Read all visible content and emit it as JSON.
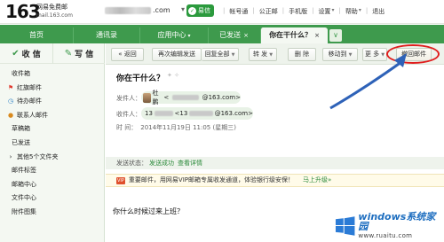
{
  "header": {
    "logo_number": "163",
    "logo_title": "网易免费邮",
    "logo_domain": "mail.163.com",
    "account_suffix": ".com",
    "account_caret": "▾",
    "letter_badge": "易信",
    "links": [
      "帐号通",
      "公正邮",
      "手机版",
      "设置",
      "帮助",
      "退出"
    ]
  },
  "tabs": {
    "home": "首页",
    "contacts": "通讯录",
    "app_center": "应用中心",
    "sent": "已发送",
    "current": "你在干什么？",
    "close": "×",
    "more": "∨"
  },
  "sidebar": {
    "receive": "收 信",
    "compose": "写 信",
    "folders": [
      {
        "label": "收件箱",
        "icon": ""
      },
      {
        "label": "红旗邮件",
        "icon": "flag-icon"
      },
      {
        "label": "待办邮件",
        "icon": "clock-icon"
      },
      {
        "label": "联系人邮件",
        "icon": "user-icon"
      },
      {
        "label": "草稿箱",
        "icon": ""
      },
      {
        "label": "已发送",
        "icon": ""
      },
      {
        "label": "其他5个文件夹",
        "icon": "expand-icon"
      },
      {
        "label": "邮件标签",
        "icon": ""
      },
      {
        "label": "邮箱中心",
        "icon": ""
      },
      {
        "label": "文件中心",
        "icon": ""
      },
      {
        "label": "附件图集",
        "icon": ""
      }
    ]
  },
  "toolbar": {
    "back": "« 返回",
    "edit_resend": "再次编辑发送",
    "reply_all": "回复全部",
    "forward": "转 发",
    "delete": "删 除",
    "move_to": "移动到",
    "more": "更 多",
    "recall": "撤回邮件",
    "highlight_color": "#e01e1e"
  },
  "message": {
    "subject": "你在干什么？",
    "sender_label": "发件人：",
    "sender_name": "杜鹏",
    "sender_email_tail": "@163.com>",
    "recipient_label": "收件人：",
    "recipient_name_head": "13",
    "recipient_email_head": "<13",
    "recipient_email_tail": "@163.com>",
    "time_label": "时 间：",
    "time_value": "2014年11月19日 11:05 (星期三)",
    "status_label": "发送状态：",
    "status_value": "发送成功",
    "status_detail": "查看详情",
    "promo_badge": "VIP",
    "promo_text": "重要邮件，用网易VIP邮箱专属收发通道，体验银行级安保！",
    "promo_link": "马上升级»",
    "body": "你什么时候过来上班？"
  },
  "watermark": {
    "brand": "windows系统家园",
    "url": "www.ruaitu.com"
  },
  "colors": {
    "brand_green": "#3e9a4d",
    "arrow_blue": "#2e62b8"
  }
}
